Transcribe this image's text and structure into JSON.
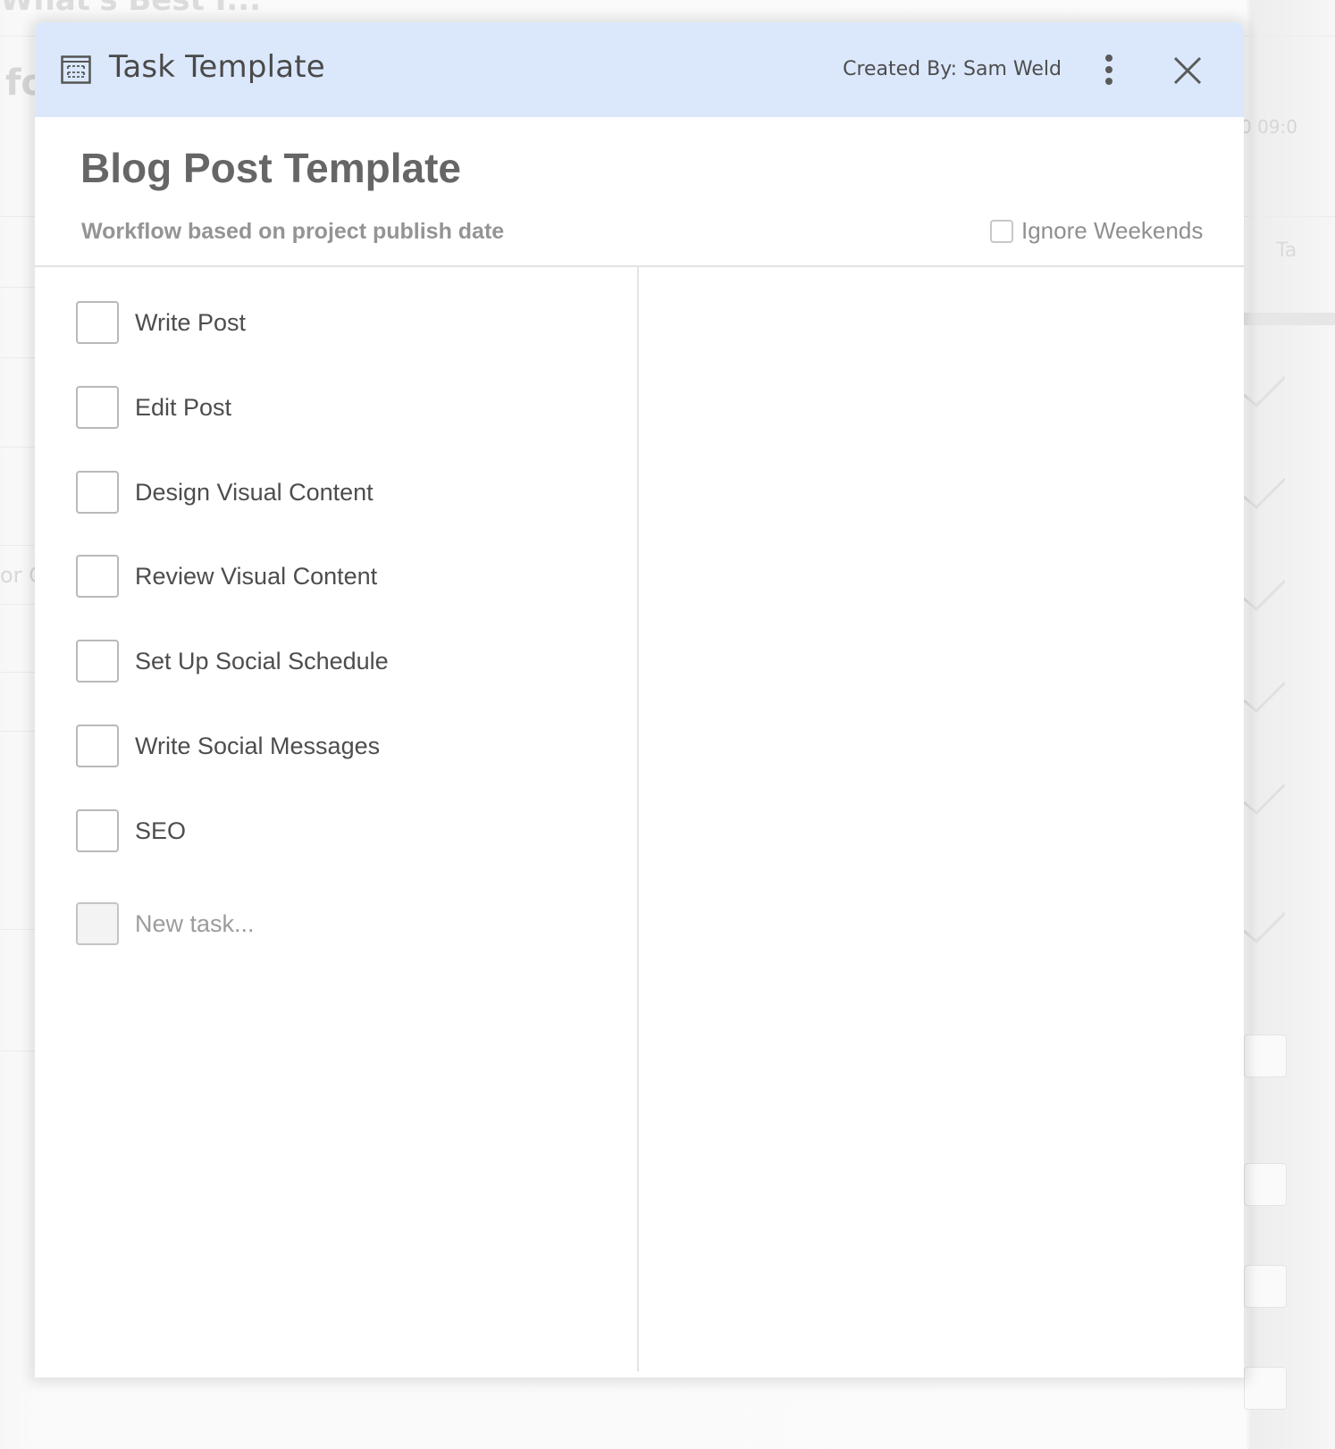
{
  "background": {
    "page_title_fragment": "What's Best I...",
    "heading_fragment": "fo",
    "row_fragment": "or C",
    "time_fragment": "0 09:0",
    "column_fragment": "Ta"
  },
  "modal": {
    "header": {
      "icon": "template-icon",
      "title": "Task Template",
      "created_by": "Created By: Sam Weld",
      "more_icon": "vertical-dots-icon",
      "close_icon": "close-icon"
    },
    "template_name": "Blog Post Template",
    "workflow_description": "Workflow based on project publish date",
    "ignore_weekends": {
      "label": "Ignore Weekends",
      "checked": false
    },
    "tasks": [
      {
        "label": "Write Post",
        "checked": false
      },
      {
        "label": "Edit Post",
        "checked": false
      },
      {
        "label": "Design Visual Content",
        "checked": false
      },
      {
        "label": "Review Visual Content",
        "checked": false
      },
      {
        "label": "Set Up Social Schedule",
        "checked": false
      },
      {
        "label": "Write Social Messages",
        "checked": false
      },
      {
        "label": "SEO",
        "checked": false
      }
    ],
    "new_task": {
      "value": "",
      "placeholder": "New task..."
    }
  }
}
